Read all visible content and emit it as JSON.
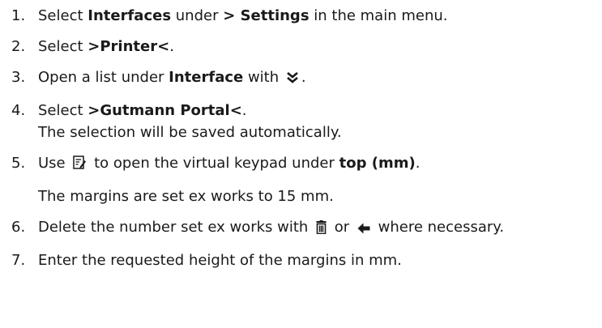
{
  "steps": [
    {
      "number": "1.",
      "pre": "Select ",
      "bold1": "Interfaces",
      "mid": " under ",
      "bold2": " > Settings",
      "post": " in the main menu."
    },
    {
      "number": "2.",
      "pre": "Select ",
      "bold1": ">Printer<",
      "post": "."
    },
    {
      "number": "3.",
      "pre": "Open a list under ",
      "bold1": "Interface",
      "mid": " with ",
      "post": ".",
      "icon": "double-chevron-down-icon"
    },
    {
      "number": "4.",
      "pre": "Select ",
      "bold1": ">Gutmann Portal<",
      "post": ".",
      "line2": "The selection will be saved automatically."
    },
    {
      "number": "5.",
      "pre": "Use ",
      "mid": " to open the virtual keypad under ",
      "bold1": "top (mm)",
      "post": ".",
      "icon": "edit-icon",
      "note": "The margins are set ex works to 15 mm."
    },
    {
      "number": "6.",
      "pre": "Delete the number set ex works with ",
      "mid": " or ",
      "post": " where necessary.",
      "icon1": "trash-icon",
      "icon2": "backspace-arrow-icon"
    },
    {
      "number": "7.",
      "text": "Enter the requested height of the margins in mm."
    }
  ]
}
